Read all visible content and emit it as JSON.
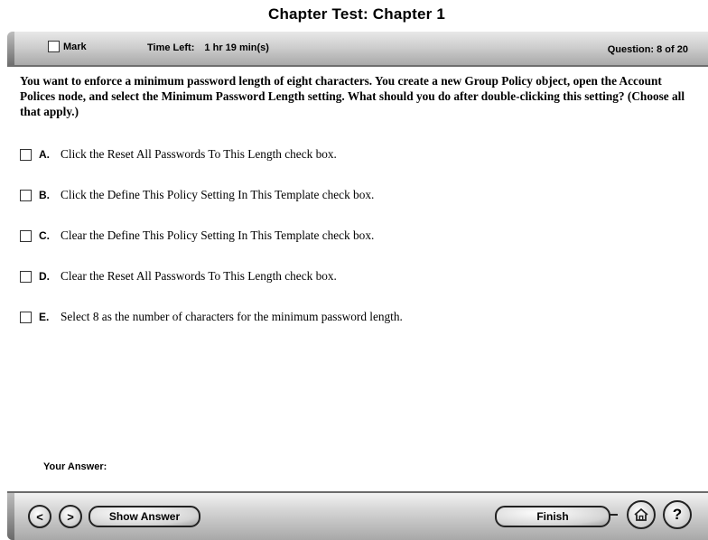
{
  "window": {
    "title": "Chapter Test:  Chapter 1"
  },
  "header": {
    "mark_label": "Mark",
    "time_label": "Time Left:",
    "time_value": "1 hr 19 min(s)",
    "question_counter": "Question: 8  of 20"
  },
  "question": {
    "text": "You want to enforce a minimum password length of eight characters. You create a new Group Policy object, open the Account Polices node, and select the Minimum Password Length setting. What should you do after double-clicking this setting? (Choose all that apply.)",
    "options": [
      {
        "letter": "A.",
        "text": "Click the Reset All Passwords To This Length check box."
      },
      {
        "letter": "B.",
        "text": "Click the Define This Policy Setting In This Template check box."
      },
      {
        "letter": "C.",
        "text": "Clear the Define This Policy Setting In This Template check box."
      },
      {
        "letter": "D.",
        "text": "Clear the Reset All Passwords To This Length check box."
      },
      {
        "letter": "E.",
        "text": "Select 8 as the number of characters for the minimum password length."
      }
    ]
  },
  "answer": {
    "label": "Your Answer:"
  },
  "footer": {
    "prev_label": "<",
    "next_label": ">",
    "show_answer_label": "Show Answer",
    "finish_label": "Finish",
    "help_label": "?",
    "home_icon": "home-icon"
  }
}
